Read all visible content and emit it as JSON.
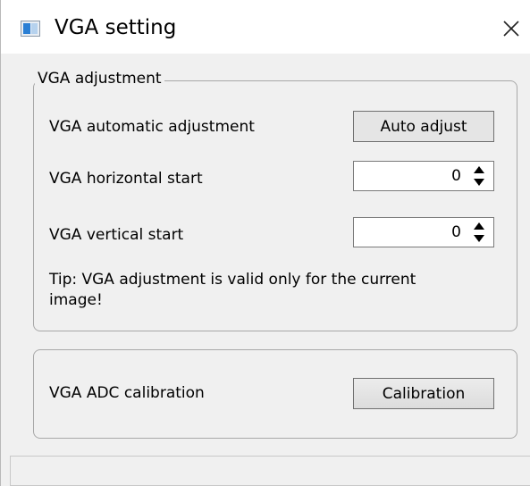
{
  "window": {
    "title": "VGA setting",
    "icons": {
      "app": "window-app-icon",
      "close": "close-icon"
    }
  },
  "adjustment_group": {
    "title": "VGA adjustment",
    "auto_label": "VGA automatic adjustment",
    "auto_button": "Auto adjust",
    "horizontal_label": "VGA horizontal start",
    "horizontal_value": "0",
    "vertical_label": "VGA vertical start",
    "vertical_value": "0",
    "tip_line1": "Tip: VGA adjustment is valid only for the current",
    "tip_line2": "image!"
  },
  "calibration_group": {
    "label": "VGA ADC calibration",
    "button": "Calibration"
  },
  "status_bar": {
    "text": ""
  }
}
